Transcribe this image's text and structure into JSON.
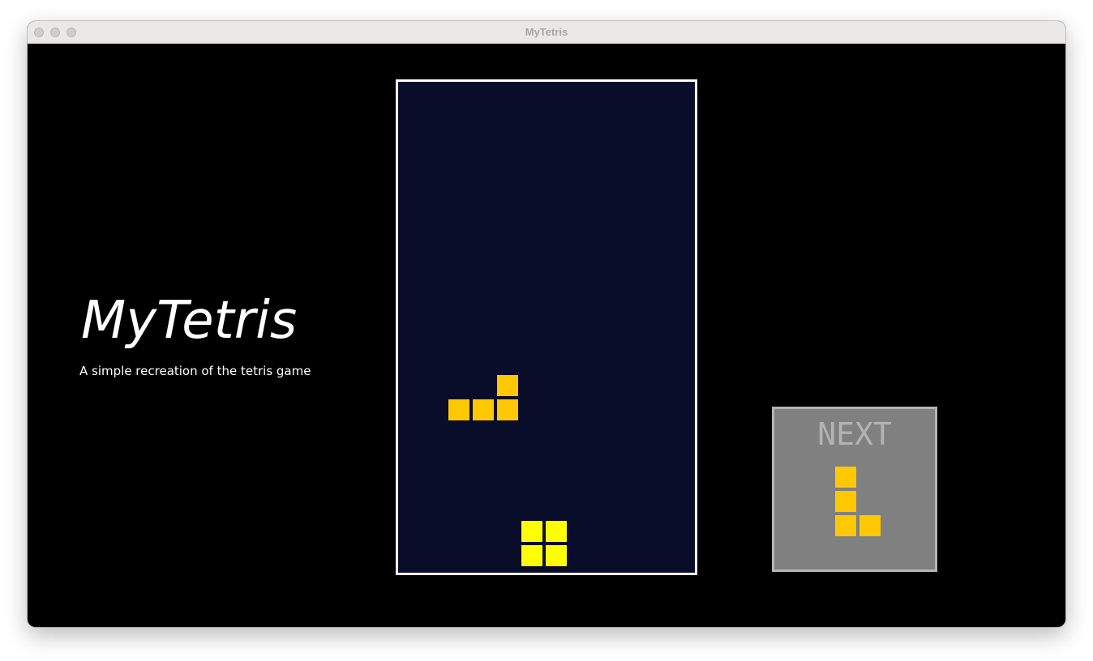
{
  "window": {
    "title": "MyTetris"
  },
  "intro": {
    "title": "MyTetris",
    "subtitle": "A simple recreation of the tetris game"
  },
  "colors": {
    "background": "#000000",
    "board_background": "#0a0d2a",
    "board_border": "#ffffff",
    "piece_orange": "#ffc800",
    "piece_yellow": "#ffff00",
    "next_panel_bg": "#808080",
    "next_panel_border": "#b5b5b5",
    "next_label": "#b3b3b3"
  },
  "board": {
    "columns": 12,
    "rows": 20,
    "falling_piece": {
      "shape": "L",
      "color": "#ffc800",
      "cells": [
        [
          4,
          12
        ],
        [
          2,
          13
        ],
        [
          3,
          13
        ],
        [
          4,
          13
        ]
      ]
    },
    "landed_piece": {
      "shape": "O",
      "color": "#ffff00",
      "cells": [
        [
          5,
          18
        ],
        [
          6,
          18
        ],
        [
          5,
          19
        ],
        [
          6,
          19
        ]
      ]
    }
  },
  "next": {
    "label": "NEXT",
    "piece": {
      "shape": "L",
      "color": "#ffc800",
      "cells": [
        [
          0,
          0
        ],
        [
          0,
          1
        ],
        [
          0,
          2
        ],
        [
          1,
          2
        ]
      ]
    }
  }
}
